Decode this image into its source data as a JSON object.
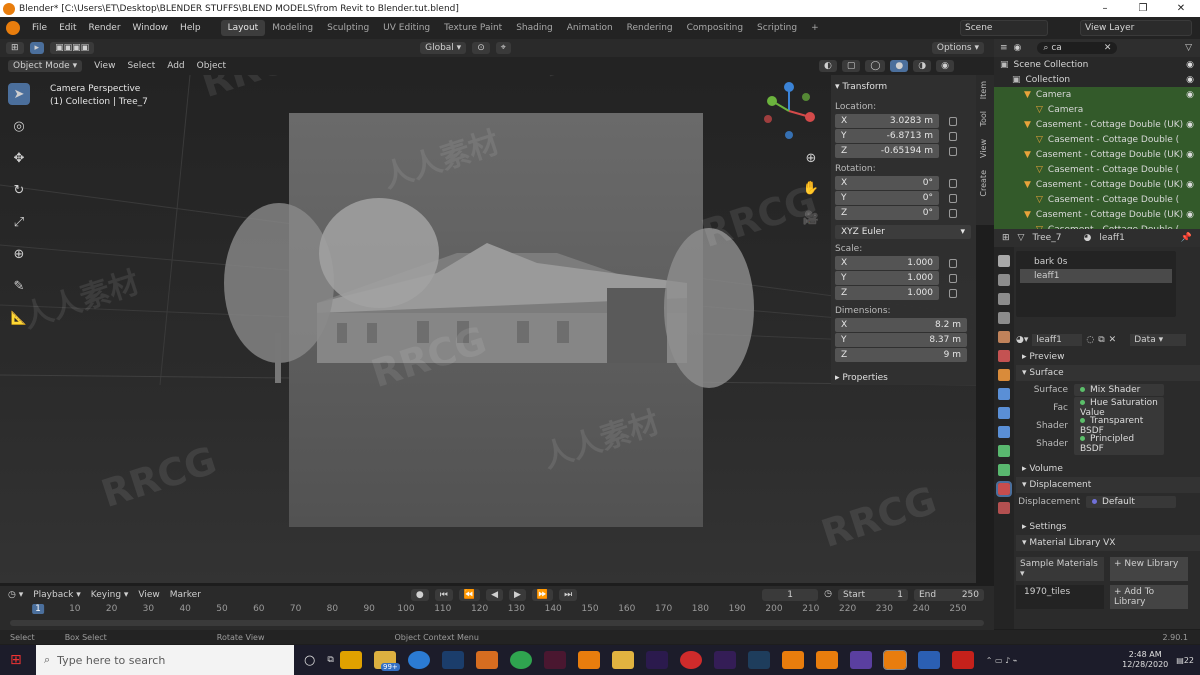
{
  "titlebar": {
    "title": "Blender* [C:\\Users\\ET\\Desktop\\BLENDER STUFFS\\BLEND MODELS\\from Revit to  Blender.tut.blend]",
    "minimize": "–",
    "maximize": "❐",
    "close": "✕"
  },
  "menu": {
    "items": [
      "File",
      "Edit",
      "Render",
      "Window",
      "Help"
    ],
    "workspaces": [
      "Layout",
      "Modeling",
      "Sculpting",
      "UV Editing",
      "Texture Paint",
      "Shading",
      "Animation",
      "Rendering",
      "Compositing",
      "Scripting"
    ],
    "add_workspace": "+",
    "scene": "Scene",
    "view_layer": "View Layer"
  },
  "viewport_header": {
    "transform_orientation": "Global",
    "options": "Options"
  },
  "viewport_menu": {
    "mode": "Object Mode",
    "items": [
      "View",
      "Select",
      "Add",
      "Object"
    ]
  },
  "viewport": {
    "camera_label": "Camera Perspective",
    "collection_label": "(1) Collection | Tree_7",
    "watermark": "RRCG",
    "watermark_cn": "人人素材"
  },
  "npanel": {
    "header": "Transform",
    "location_label": "Location:",
    "location": [
      {
        "axis": "X",
        "value": "3.0283 m"
      },
      {
        "axis": "Y",
        "value": "-6.8713 m"
      },
      {
        "axis": "Z",
        "value": "-0.65194 m"
      }
    ],
    "rotation_label": "Rotation:",
    "rotation": [
      {
        "axis": "X",
        "value": "0°"
      },
      {
        "axis": "Y",
        "value": "0°"
      },
      {
        "axis": "Z",
        "value": "0°"
      }
    ],
    "rotation_mode": "XYZ Euler",
    "scale_label": "Scale:",
    "scale": [
      {
        "axis": "X",
        "value": "1.000"
      },
      {
        "axis": "Y",
        "value": "1.000"
      },
      {
        "axis": "Z",
        "value": "1.000"
      }
    ],
    "dimensions_label": "Dimensions:",
    "dimensions": [
      {
        "axis": "X",
        "value": "8.2 m"
      },
      {
        "axis": "Y",
        "value": "8.37 m"
      },
      {
        "axis": "Z",
        "value": "9 m"
      }
    ],
    "properties": "Properties",
    "tabs": [
      "Item",
      "Tool",
      "View",
      "Create"
    ]
  },
  "outliner": {
    "search": "ca",
    "rows": [
      {
        "label": "Scene Collection",
        "hl": false,
        "indent": 0
      },
      {
        "label": "Collection",
        "hl": false,
        "indent": 1
      },
      {
        "label": "Camera",
        "hl": true,
        "indent": 2
      },
      {
        "label": "Camera",
        "hl": true,
        "indent": 3
      },
      {
        "label": "Casement - Cottage Double (UK)",
        "hl": true,
        "indent": 2
      },
      {
        "label": "Casement - Cottage Double (",
        "hl": true,
        "indent": 3
      },
      {
        "label": "Casement - Cottage Double (UK)",
        "hl": true,
        "indent": 2
      },
      {
        "label": "Casement - Cottage Double (",
        "hl": true,
        "indent": 3
      },
      {
        "label": "Casement - Cottage Double (UK)",
        "hl": true,
        "indent": 2
      },
      {
        "label": "Casement - Cottage Double (",
        "hl": true,
        "indent": 3
      },
      {
        "label": "Casement - Cottage Double (UK)",
        "hl": true,
        "indent": 2
      },
      {
        "label": "Casement - Cottage Double (",
        "hl": true,
        "indent": 3
      }
    ]
  },
  "properties": {
    "object": "Tree_7",
    "material": "leaff1",
    "slots": [
      "bark 0s",
      "leaff1"
    ],
    "material_name": "leaff1",
    "link": "Data",
    "sections": {
      "preview": "Preview",
      "surface": "Surface",
      "volume": "Volume",
      "displacement": "Displacement",
      "settings": "Settings",
      "material_library": "Material Library VX"
    },
    "surface_fields": [
      {
        "k": "Surface",
        "v": "Mix Shader"
      },
      {
        "k": "Fac",
        "v": "Hue Saturation Value"
      },
      {
        "k": "Shader",
        "v": "Transparent BSDF"
      },
      {
        "k": "Shader",
        "v": "Principled BSDF"
      }
    ],
    "displacement_field": {
      "k": "Displacement",
      "v": "Default"
    },
    "library": {
      "dropdown": "Sample Materials",
      "new_library": "New Library",
      "add_to_library": "Add To Library",
      "item": "1970_tiles"
    }
  },
  "timeline": {
    "menu": [
      "Playback",
      "Keying",
      "View",
      "Marker"
    ],
    "current_frame": "1",
    "start_label": "Start",
    "start": "1",
    "end_label": "End",
    "end": "250",
    "ticks": [
      "1",
      "10",
      "20",
      "30",
      "40",
      "50",
      "60",
      "70",
      "80",
      "90",
      "100",
      "110",
      "120",
      "130",
      "140",
      "150",
      "160",
      "170",
      "180",
      "190",
      "200",
      "210",
      "220",
      "230",
      "240",
      "250"
    ]
  },
  "statusbar": {
    "items": [
      "Select",
      "Box Select",
      "Rotate View",
      "Object Context Menu"
    ],
    "version": "2.90.1"
  },
  "taskbar": {
    "search_placeholder": "Type here to search",
    "time": "2:48 AM",
    "date": "12/28/2020",
    "mail_badge": "99+",
    "notifications": "22"
  }
}
